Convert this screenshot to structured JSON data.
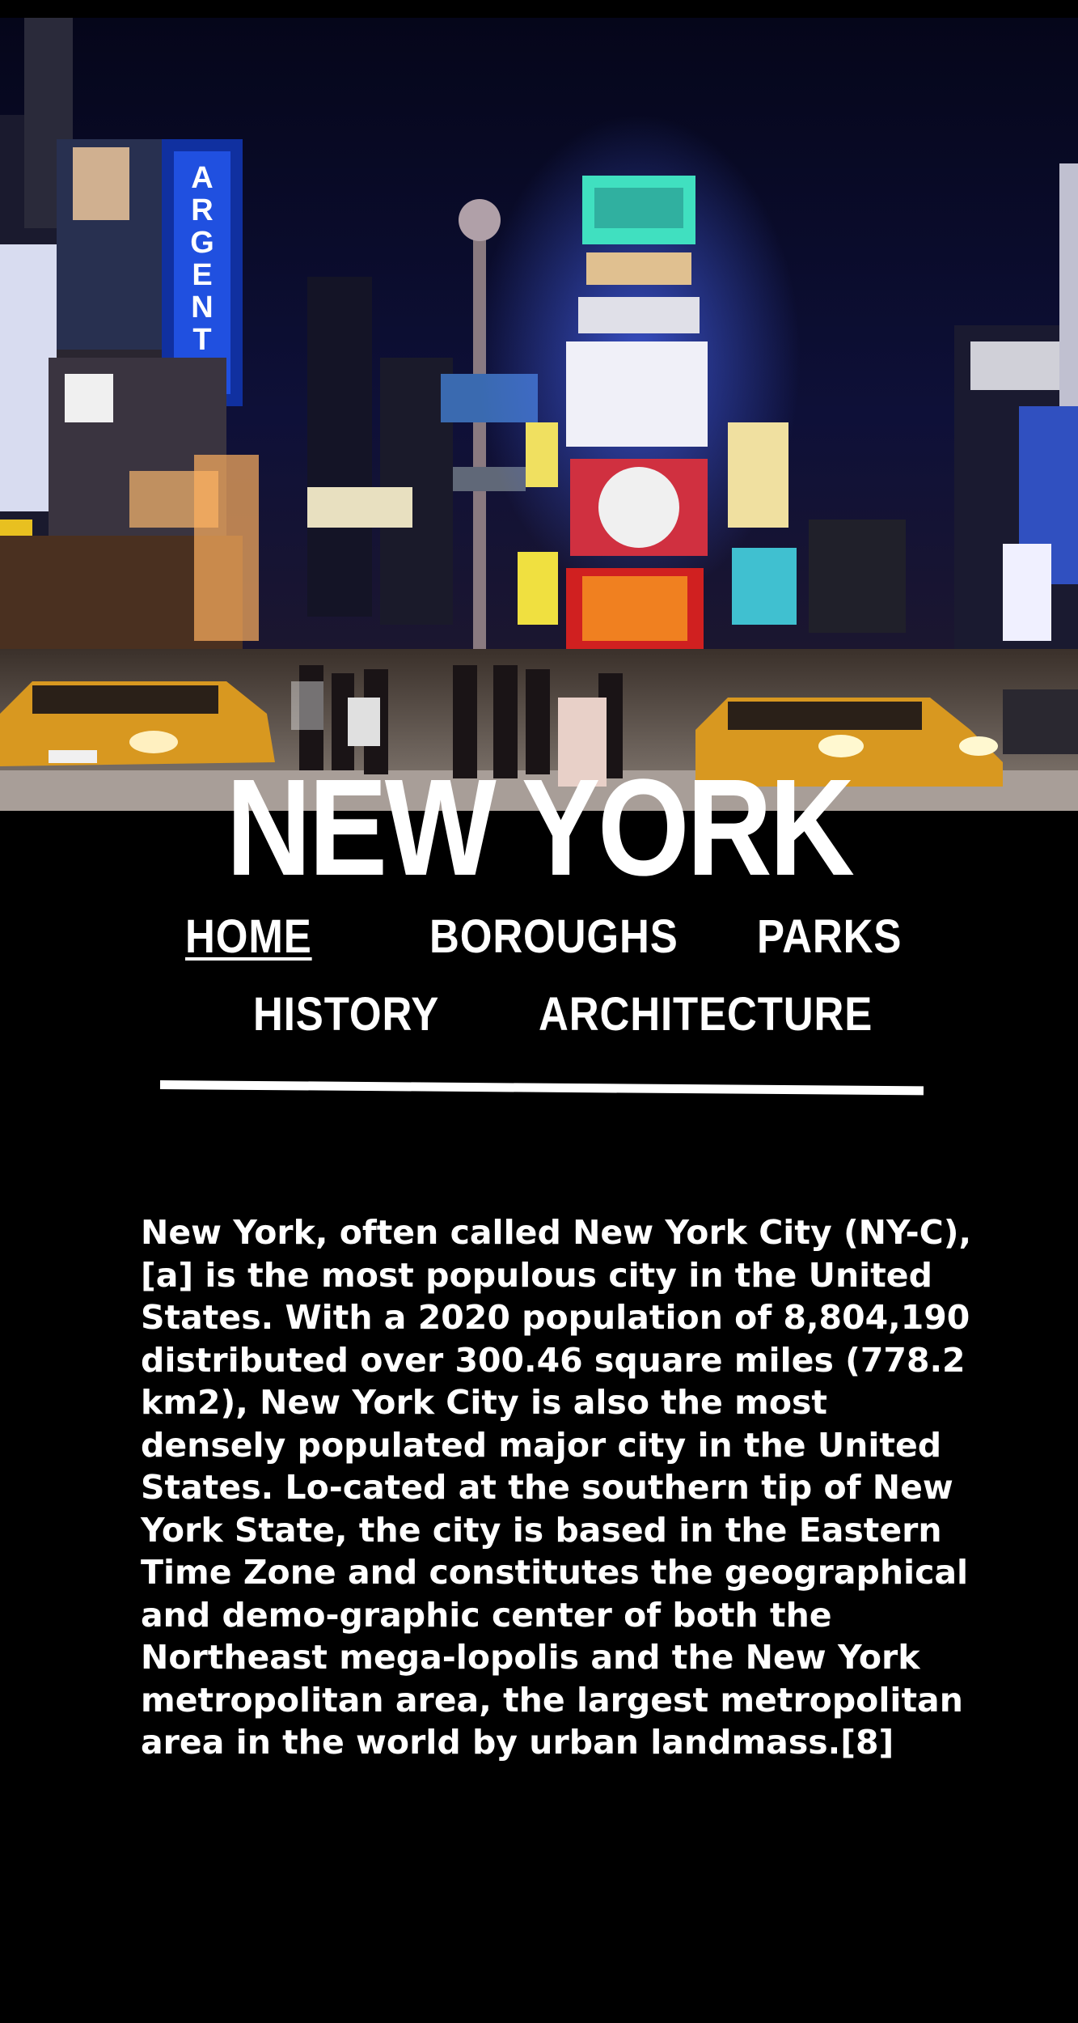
{
  "hero": {
    "image_description_icon": "times-square-night-photo"
  },
  "site": {
    "title": "NEW YORK"
  },
  "nav": {
    "items": [
      {
        "label": "HOME",
        "active": true
      },
      {
        "label": "BOROUGHS",
        "active": false
      },
      {
        "label": "PARKS",
        "active": false
      },
      {
        "label": "HISTORY",
        "active": false
      },
      {
        "label": "ARCHITECTURE",
        "active": false
      }
    ]
  },
  "content": {
    "intro": "New York, often called New York City (NY-C),[a] is the most populous city in the United States. With a 2020 population of 8,804,190 distributed over 300.46 square miles (778.2 km2), New York City is also the most densely populated major city in the United States. Lo-cated at the southern tip of New York State, the city is based in the Eastern Time Zone and constitutes the geographical and demo-graphic center of both the Northeast mega-lopolis and the New York metropolitan area, the largest metropolitan area in the world by urban landmass.[8]"
  },
  "colors": {
    "background": "#000000",
    "text": "#ffffff",
    "taxi": "#e0a020",
    "sky": "#0c0e2e"
  }
}
